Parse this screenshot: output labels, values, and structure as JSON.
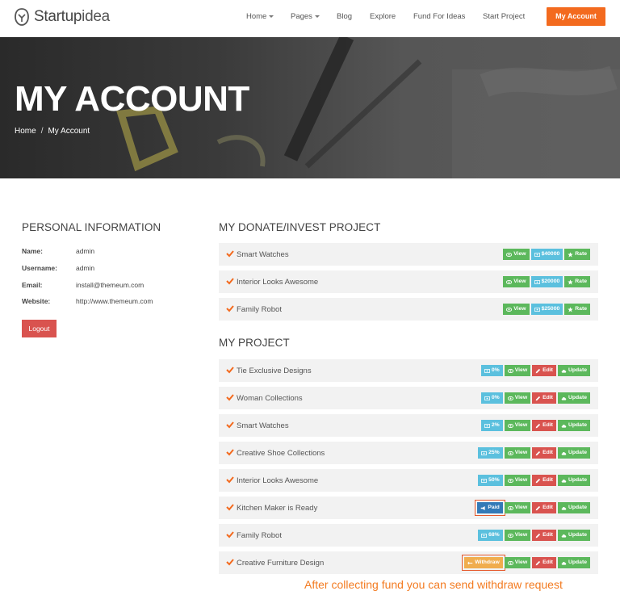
{
  "brand": {
    "name_part1": "Startup",
    "name_part2": "idea"
  },
  "nav": {
    "items": [
      {
        "label": "Home",
        "dropdown": true
      },
      {
        "label": "Pages",
        "dropdown": true
      },
      {
        "label": "Blog",
        "dropdown": false
      },
      {
        "label": "Explore",
        "dropdown": false
      },
      {
        "label": "Fund For Ideas",
        "dropdown": false
      },
      {
        "label": "Start Project",
        "dropdown": false
      }
    ],
    "account_button": "My Account"
  },
  "hero": {
    "title": "MY ACCOUNT",
    "breadcrumb": [
      "Home",
      "My Account"
    ],
    "breadcrumb_separator": "/"
  },
  "personal": {
    "heading": "PERSONAL INFORMATION",
    "fields": [
      {
        "label": "Name:",
        "value": "admin"
      },
      {
        "label": "Username:",
        "value": "admin"
      },
      {
        "label": "Email:",
        "value": "install@themeum.com"
      },
      {
        "label": "Website:",
        "value": "http://www.themeum.com"
      }
    ],
    "logout_label": "Logout"
  },
  "donate": {
    "heading": "MY DONATE/INVEST PROJECT",
    "rows": [
      {
        "name": "Smart Watches",
        "amount": "$40000"
      },
      {
        "name": "Interior Looks Awesome",
        "amount": "$20000"
      },
      {
        "name": "Family Robot",
        "amount": "$25000"
      }
    ],
    "view_label": "View",
    "rate_label": "Rate"
  },
  "projects": {
    "heading": "MY PROJECT",
    "rows": [
      {
        "name": "Tie Exclusive Designs",
        "status": "0%",
        "status_type": "percent"
      },
      {
        "name": "Woman Collections",
        "status": "0%",
        "status_type": "percent"
      },
      {
        "name": "Smart Watches",
        "status": "2%",
        "status_type": "percent"
      },
      {
        "name": "Creative Shoe Collections",
        "status": "25%",
        "status_type": "percent"
      },
      {
        "name": "Interior Looks Awesome",
        "status": "50%",
        "status_type": "percent"
      },
      {
        "name": "Kitchen Maker is Ready",
        "status": "Paid",
        "status_type": "paid"
      },
      {
        "name": "Family Robot",
        "status": "68%",
        "status_type": "percent"
      },
      {
        "name": "Creative Furniture Design",
        "status": "Withdraw",
        "status_type": "withdraw"
      }
    ],
    "view_label": "View",
    "edit_label": "Edit",
    "update_label": "Update"
  },
  "annotation": "After collecting fund you can send withdraw request",
  "colors": {
    "brand_orange": "#f36a1e",
    "green": "#5cb85c",
    "blue": "#5bc0de",
    "red": "#d9534f",
    "navy": "#337ab7",
    "orange": "#f0ad4e"
  }
}
